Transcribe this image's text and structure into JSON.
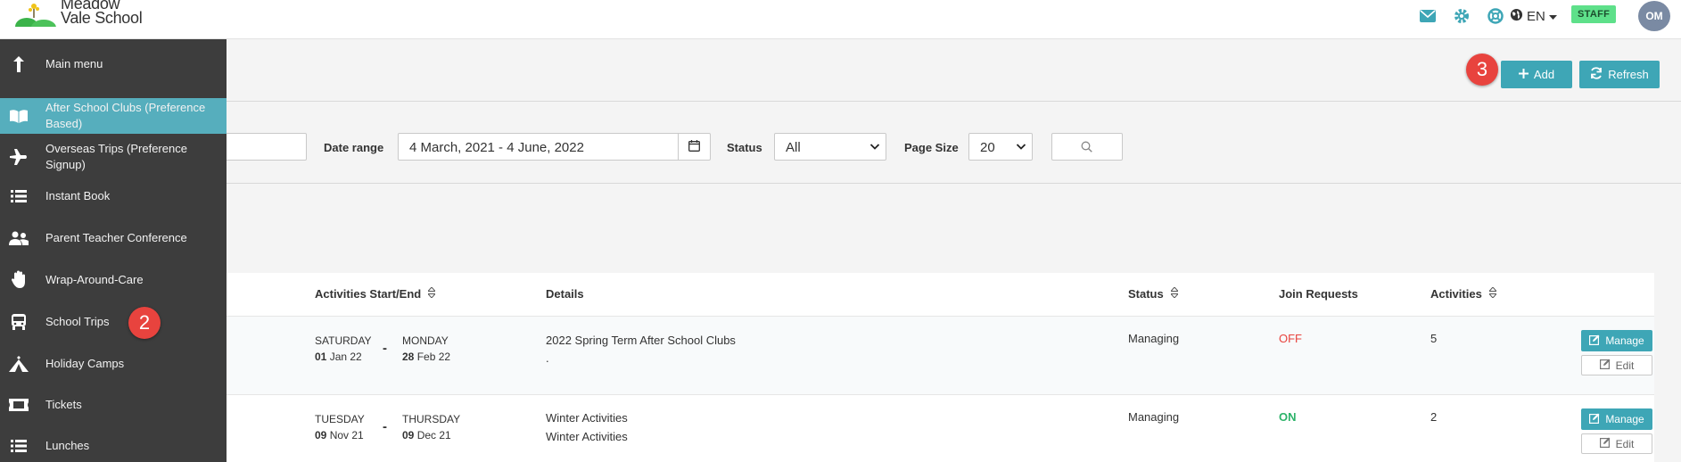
{
  "header": {
    "logo_line1": "Meadow",
    "logo_line2": "Vale School",
    "lang": "EN",
    "role_badge": "STAFF",
    "avatar_initials": "OM"
  },
  "sidebar": {
    "items": [
      {
        "label": "Main menu",
        "icon": "arrow-up-icon"
      },
      {
        "label": "After School Clubs (Preference Based)",
        "icon": "book-open-icon"
      },
      {
        "label": "Overseas Trips (Preference Signup)",
        "icon": "plane-icon"
      },
      {
        "label": "Instant Book",
        "icon": "list-icon"
      },
      {
        "label": "Parent Teacher Conference",
        "icon": "users-icon"
      },
      {
        "label": "Wrap-Around-Care",
        "icon": "hand-icon"
      },
      {
        "label": "School Trips",
        "icon": "bus-icon"
      },
      {
        "label": "Holiday Camps",
        "icon": "tent-icon"
      },
      {
        "label": "Tickets",
        "icon": "ticket-icon"
      },
      {
        "label": "Lunches",
        "icon": "list-icon"
      }
    ],
    "active_index": 1
  },
  "toolbar": {
    "add_label": "Add",
    "refresh_label": "Refresh"
  },
  "annotations": {
    "badge_2": "2",
    "badge_3": "3"
  },
  "filters": {
    "date_range_label": "Date range",
    "date_range_value": "4 March, 2021 - 4 June, 2022",
    "status_label": "Status",
    "status_value": "All",
    "page_size_label": "Page Size",
    "page_size_value": "20"
  },
  "table": {
    "columns": {
      "start_end": "Activities Start/End",
      "details": "Details",
      "status": "Status",
      "join_requests": "Join Requests",
      "activities": "Activities"
    },
    "rows": [
      {
        "start_day": "SATURDAY",
        "start_num": "01",
        "start_rest": "Jan 22",
        "end_day": "MONDAY",
        "end_num": "28",
        "end_rest": "Feb 22",
        "title": "2022 Spring Term After School Clubs",
        "subtitle": ".",
        "status": "Managing",
        "join": "OFF",
        "activities": "5",
        "manage": "Manage",
        "edit": "Edit"
      },
      {
        "start_day": "TUESDAY",
        "start_num": "09",
        "start_rest": "Nov 21",
        "end_day": "THURSDAY",
        "end_num": "09",
        "end_rest": "Dec 21",
        "title": "Winter Activities",
        "subtitle": "Winter Activities",
        "status": "Managing",
        "join": "ON",
        "activities": "2",
        "manage": "Manage",
        "edit": "Edit"
      }
    ],
    "dash": "-"
  },
  "colors": {
    "accent": "#3ea6b6",
    "sidebar_bg": "#3d3d3d",
    "sidebar_active": "#56aebd",
    "badge_red": "#e8433e",
    "staff_green": "#5ee08a",
    "off_red": "#e8433e",
    "on_green": "#2db36a"
  }
}
